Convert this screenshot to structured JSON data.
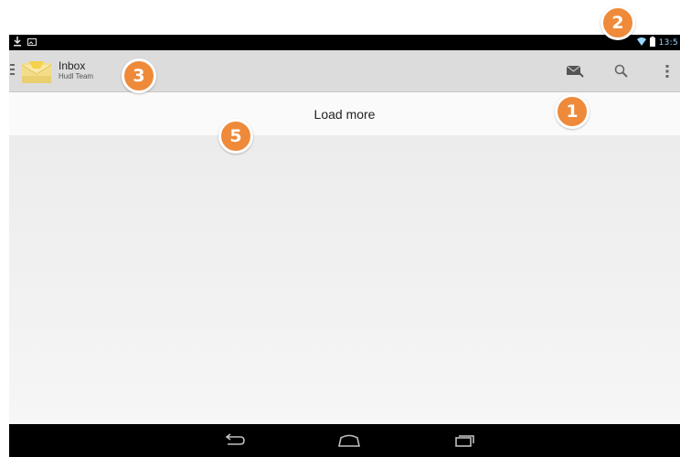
{
  "status_bar": {
    "time": "13:5",
    "left_icons": [
      "download-icon",
      "image-icon"
    ],
    "right_icons": [
      "wifi-icon",
      "battery-icon"
    ]
  },
  "action_bar": {
    "title": "Inbox",
    "subtitle": "Hudl Team",
    "actions": [
      "compose-mail-icon",
      "search-icon",
      "overflow-menu-icon"
    ]
  },
  "content": {
    "load_more_label": "Load more"
  },
  "nav_bar": {
    "buttons": [
      "back-icon",
      "home-icon",
      "recent-apps-icon"
    ]
  },
  "callouts": {
    "one": "1",
    "two": "2",
    "three": "3",
    "five": "5"
  },
  "colors": {
    "callout": "#ee8a3a",
    "action_bar": "#dcdcdc",
    "status_accent": "#9ad6ff"
  }
}
